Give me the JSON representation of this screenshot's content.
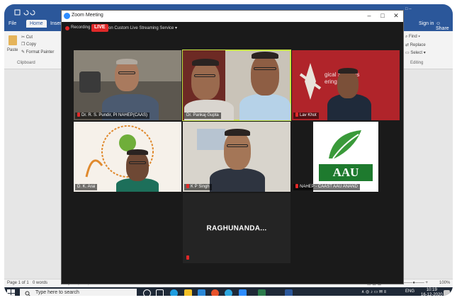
{
  "word": {
    "tabs": [
      "File",
      "Home",
      "Insert"
    ],
    "active_tab": "Home",
    "clipboard": {
      "paste": "Paste",
      "cut": "Cut",
      "copy": "Copy",
      "format_painter": "Format Painter",
      "group": "Clipboard"
    },
    "editing": {
      "find": "Find",
      "replace": "Replace",
      "select": "Select",
      "group": "Editing"
    },
    "sign_in": "Sign in",
    "share": "Share",
    "status": {
      "page": "Page 1 of 1",
      "words": "0 words",
      "language": "English (India)",
      "zoom": "100%"
    }
  },
  "taskbar": {
    "search_placeholder": "Type here to search",
    "lang": "ENG",
    "time": "10:19",
    "date": "16-12-2020"
  },
  "zoom": {
    "window_title": "Zoom Meeting",
    "recording": "Recording",
    "live": "LIVE",
    "live_service": "on Custom Live Streaming Service",
    "participants": [
      {
        "name": "Dr. R. S. Pundir, PI NAHEP(CAAS)"
      },
      {
        "name": "Dr. Pankaj Gupta"
      },
      {
        "name": "Lav Khot"
      },
      {
        "name": "D. K. Arai"
      },
      {
        "name": "K P Singh"
      },
      {
        "name": "NAHEP - CAAST AAU ANAND"
      },
      {
        "name": "RAGHUNANDA..."
      }
    ],
    "logo_text": "AAU",
    "bg_text": "gical Systems\nering"
  },
  "colors": {
    "word_blue": "#2b579a",
    "zoom_live_red": "#e02828",
    "speaker_border": "#c8e645"
  }
}
